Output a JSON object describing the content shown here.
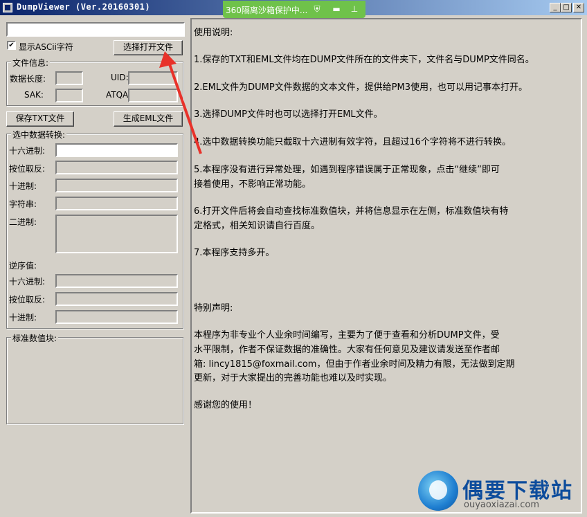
{
  "window": {
    "title": "DumpViewer (Ver.20160301)"
  },
  "sandbox": {
    "label": "360隔离沙箱保护中..."
  },
  "left": {
    "file_path_value": "",
    "show_ascii_label": "显示ASCii字符",
    "show_ascii_checked": "✔",
    "select_file_button": "选择打开文件",
    "file_info": {
      "legend": "文件信息:",
      "data_length_label": "数据长度:",
      "uid_label": "UID:",
      "sak_label": "SAK:",
      "atqa_label": "ATQA:"
    },
    "save_txt_button": "保存TXT文件",
    "gen_eml_button": "生成EML文件",
    "conversion": {
      "legend": "选中数据转换:",
      "hex_label": "十六进制:",
      "invert_label": "按位取反:",
      "decimal_label": "十进制:",
      "string_label": "字符串:",
      "binary_label": "二进制:",
      "reverse_label": "逆序值:",
      "rev_hex_label": "十六进制:",
      "rev_invert_label": "按位取反:",
      "rev_decimal_label": "十进制:"
    },
    "standard_block": {
      "legend": "标准数值块:"
    }
  },
  "readme": {
    "lines": [
      "使用说明:",
      "1.保存的TXT和EML文件均在DUMP文件所在的文件夹下，文件名与DUMP文件同名。",
      "2.EML文件为DUMP文件数据的文本文件，提供给PM3使用，也可以用记事本打开。",
      "3.选择DUMP文件时也可以选择打开EML文件。",
      "4.选中数据转换功能只截取十六进制有效字符，且超过16个字符将不进行转换。",
      "5.本程序没有进行异常处理，如遇到程序错误属于正常现象，点击“继续”即可",
      "接着使用，不影响正常功能。",
      "6.打开文件后将会自动查找标准数值块，并将信息显示在左侧，标准数值块有特",
      "定格式，相关知识请自行百度。",
      "7.本程序支持多开。",
      "特别声明:",
      "      本程序为非专业个人业余时间编写，主要为了便于查看和分析DUMP文件，受",
      "水平限制，作者不保证数据的准确性。大家有任何意见及建议请发送至作者邮",
      "箱: lincy1815@foxmail.com，但由于作者业余时间及精力有限，无法做到定期",
      "更新，对于大家提出的完善功能也难以及时实现。",
      "      感谢您的使用！"
    ]
  },
  "watermark": {
    "title": "偶要下载站",
    "url": "ouyaoxiazai.com"
  },
  "colors": {
    "title_bar": "#0a246a",
    "sandbox": "#6fc24a",
    "arrow": "#e8322a",
    "watermark": "#0d4c9c"
  }
}
